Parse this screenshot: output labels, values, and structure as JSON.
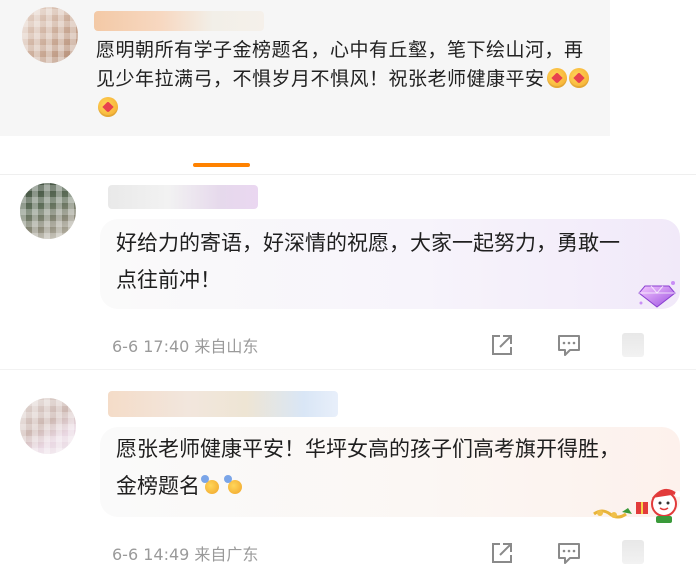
{
  "top_card": {
    "text": "愿明朝所有学子金榜题名，心中有丘壑，笔下绘山河，再见少年拉满弓，不惧岁月不惧风！祝张老师健康平安",
    "emojis": [
      "hug-emoji",
      "hug-emoji",
      "hug-emoji"
    ]
  },
  "comments": [
    {
      "text": "好给力的寄语，好深情的祝愿，大家一起努力，勇敢一点往前冲！",
      "meta": "6-6 17:40 来自山东",
      "badge_icon": "diamond-badge-icon"
    },
    {
      "text": "愿张老师健康平安！华坪女高的孩子们高考旗开得胜，金榜题名",
      "emojis": [
        "cheer-emoji",
        "cheer-emoji"
      ],
      "meta": "6-6 14:49 来自广东",
      "badge_icon": "christmas-badge-icon"
    }
  ],
  "colors": {
    "accent": "#ff8200",
    "meta_text": "#9a9a9a"
  }
}
